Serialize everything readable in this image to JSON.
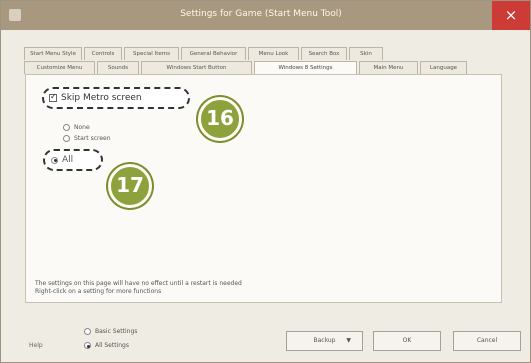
{
  "window": {
    "title": "Settings for Game (Start Menu Tool)",
    "close_label": "×"
  },
  "tabs": {
    "top": [
      "Start Menu Style",
      "Controls",
      "Special Items",
      "General Behavior",
      "Menu Look",
      "Search Box",
      "Skin"
    ],
    "bottom": [
      "Customize Menu",
      "Sounds",
      "Windows Start Button",
      "Windows 8 Settings",
      "Main Menu",
      "Language"
    ],
    "active": "Windows 8 Settings"
  },
  "options": {
    "skip_metro": "Skip Metro screen",
    "none": "None",
    "start_screen": "Start screen",
    "all": "All"
  },
  "footer": {
    "note_line1": "The settings on this page will have no effect until a restart is needed",
    "note_line2": "Right-click on a setting for more functions",
    "help": "Help",
    "basic_settings": "Basic Settings",
    "all_settings": "All Settings",
    "backup": "Backup",
    "ok": "OK",
    "cancel": "Cancel"
  },
  "annotations": {
    "badge_16": "16",
    "badge_17": "17"
  }
}
